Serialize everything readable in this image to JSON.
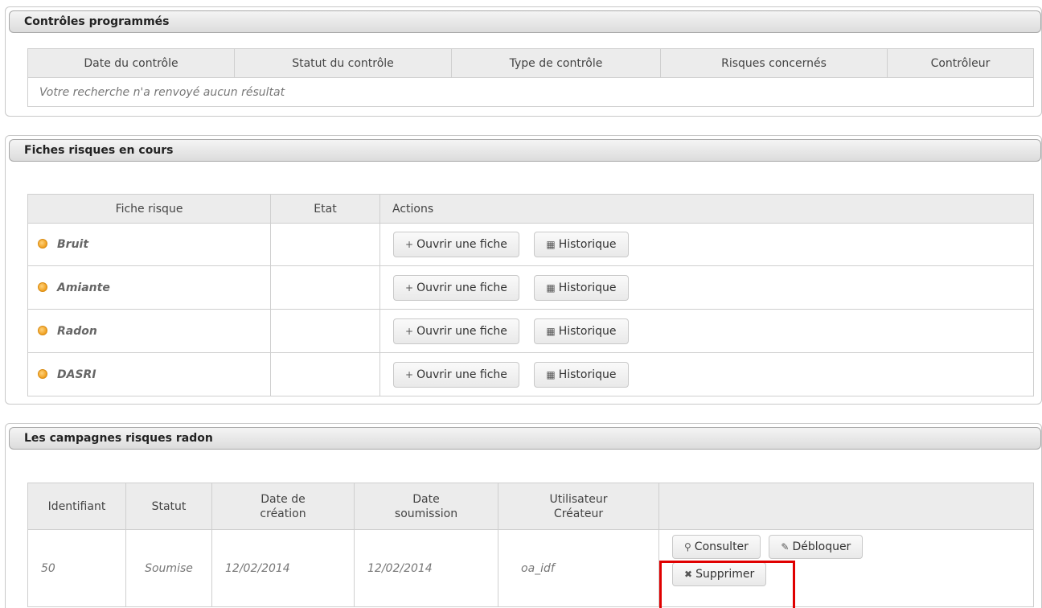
{
  "controles": {
    "title": "Contrôles programmés",
    "headers": [
      "Date du contrôle",
      "Statut du contrôle",
      "Type de contrôle",
      "Risques concernés",
      "Contrôleur"
    ],
    "empty_message": "Votre recherche n'a renvoyé aucun résultat"
  },
  "fiches": {
    "title": "Fiches risques en cours",
    "headers": [
      "Fiche risque",
      "Etat",
      "Actions"
    ],
    "rows": [
      {
        "name": "Bruit",
        "etat": ""
      },
      {
        "name": "Amiante",
        "etat": ""
      },
      {
        "name": "Radon",
        "etat": ""
      },
      {
        "name": "DASRI",
        "etat": ""
      }
    ],
    "open_label": "Ouvrir une fiche",
    "history_label": "Historique"
  },
  "campagnes": {
    "title": "Les campagnes risques radon",
    "headers": {
      "identifiant": "Identifiant",
      "statut": "Statut",
      "date_creation_1": "Date de",
      "date_creation_2": "création",
      "date_soumission_1": "Date",
      "date_soumission_2": "soumission",
      "utilisateur_1": "Utilisateur",
      "utilisateur_2": "Créateur",
      "actions": ""
    },
    "row": {
      "identifiant": "50",
      "statut": "Soumise",
      "date_creation": "12/02/2014",
      "date_soumission": "12/02/2014",
      "utilisateur": "oa_idf"
    },
    "consult_label": "Consulter",
    "unlock_label": "Débloquer",
    "delete_label": "Supprimer"
  },
  "icons": {
    "plus": "plus-icon",
    "history": "calendar-icon",
    "search": "search-icon",
    "pencil": "pencil-icon",
    "delete": "cross-icon",
    "status": "status-dot-icon"
  },
  "colors": {
    "highlight": "#e00000",
    "status_dot": "#f0a020"
  }
}
